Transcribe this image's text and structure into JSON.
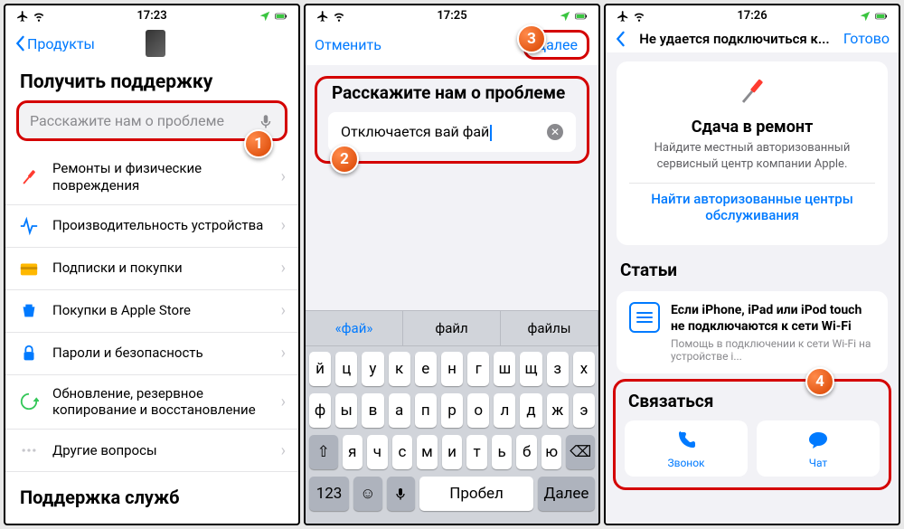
{
  "status": {
    "time1": "17:23",
    "time2": "17:25",
    "time3": "17:26"
  },
  "panel1": {
    "back": "Продукты",
    "title": "Получить поддержку",
    "search_ph": "Расскажите нам о проблеме",
    "items": [
      "Ремонты и физические повреждения",
      "Производительность устройства",
      "Подписки и покупки",
      "Покупки в Apple Store",
      "Пароли и безопасность",
      "Обновление, резервное копирование и восстановление",
      "Другие вопросы"
    ],
    "footer": "Поддержка служб"
  },
  "panel2": {
    "cancel": "Отменить",
    "next": "Далее",
    "label": "Расскажите нам о проблеме",
    "input": "Отключается вай фай",
    "suggestions": [
      "«фай»",
      "файл",
      "файлы"
    ],
    "kb_rows": [
      [
        "й",
        "ц",
        "у",
        "к",
        "е",
        "н",
        "г",
        "ш",
        "щ",
        "з",
        "х"
      ],
      [
        "ф",
        "ы",
        "в",
        "а",
        "п",
        "р",
        "о",
        "л",
        "д",
        "ж",
        "э"
      ],
      [
        "я",
        "ч",
        "с",
        "м",
        "и",
        "т",
        "ь",
        "б",
        "ю"
      ]
    ],
    "kb_space": "Пробел",
    "kb_next": "Далее",
    "kb_123": "123"
  },
  "panel3": {
    "title": "Не удается подключиться к...",
    "done": "Готово",
    "card_title": "Сдача в ремонт",
    "card_sub": "Найдите местный авторизованный сервисный центр компании Apple.",
    "card_link": "Найти авторизованные центры обслуживания",
    "articles_h": "Статьи",
    "art_title": "Если iPhone, iPad или iPod touch не подключаются к сети Wi-Fi",
    "art_sub": "Помощь в подключении к сети Wi-Fi на устройстве i...",
    "contact_h": "Связаться",
    "call": "Звонок",
    "chat": "Чат"
  },
  "badges": {
    "b1": "1",
    "b2": "2",
    "b3": "3",
    "b4": "4"
  }
}
